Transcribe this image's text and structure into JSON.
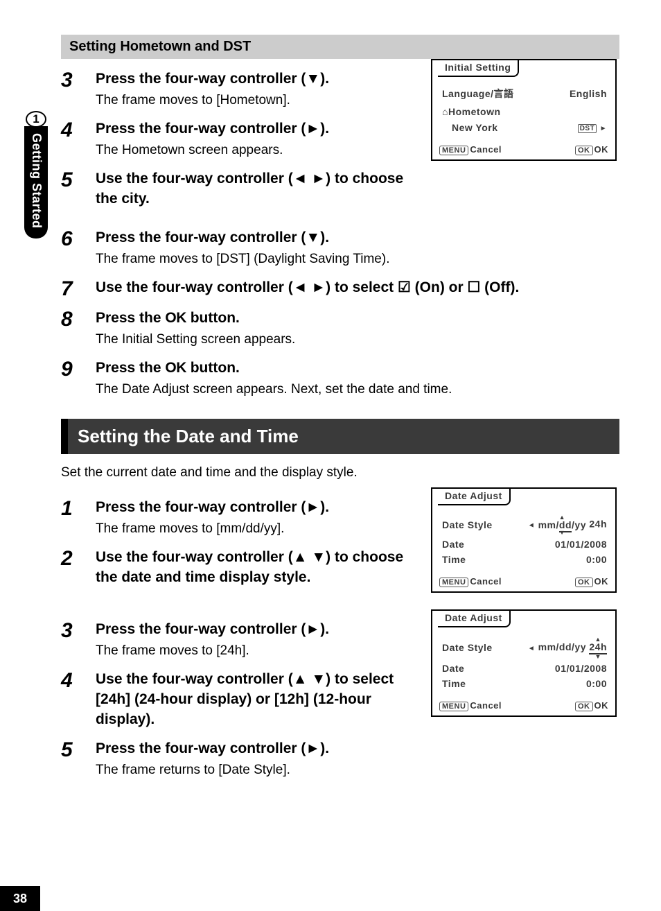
{
  "pageNumber": "38",
  "sideTab": {
    "chapter": "1",
    "label": "Getting Started"
  },
  "subhead1": "Setting Hometown and DST",
  "stepsA": [
    {
      "n": "3",
      "title_pre": "Press the four-way controller (",
      "arrow": "▼",
      "title_post": ").",
      "desc": "The frame moves to [Hometown]."
    },
    {
      "n": "4",
      "title_pre": "Press the four-way controller (",
      "arrow": "►",
      "title_post": ").",
      "desc": "The Hometown screen appears."
    },
    {
      "n": "5",
      "title_pre": "Use the four-way controller (",
      "arrow": "◄ ►",
      "title_post": ") to choose the city.",
      "desc": ""
    },
    {
      "n": "6",
      "title_pre": "Press the four-way controller (",
      "arrow": "▼",
      "title_post": ").",
      "desc": "The frame moves to [DST] (Daylight Saving Time)."
    },
    {
      "n": "7",
      "title_pre": "Use the four-way controller (",
      "arrow": "◄ ►",
      "title_post": ") to select ",
      "icon_on": "☑",
      "mid": " (On) or ",
      "icon_off": "☐",
      "end": " (Off).",
      "desc": ""
    },
    {
      "n": "8",
      "title_pre": "Press the ",
      "ok": "OK",
      "title_post": " button.",
      "desc": "The Initial Setting screen appears."
    },
    {
      "n": "9",
      "title_pre": "Press the ",
      "ok": "OK",
      "title_post": " button.",
      "desc": "The Date Adjust screen appears. Next, set the date and time."
    }
  ],
  "sectionTitle": "Setting the Date and Time",
  "intro": "Set the current date and time and the display style.",
  "stepsB": [
    {
      "n": "1",
      "title_pre": "Press the four-way controller (",
      "arrow": "►",
      "title_post": ").",
      "desc": "The frame moves to [mm/dd/yy]."
    },
    {
      "n": "2",
      "title_pre": "Use the four-way controller (",
      "arrow": "▲ ▼",
      "title_post": ") to choose the date and time display style.",
      "desc": ""
    },
    {
      "n": "3",
      "title_pre": "Press the four-way controller (",
      "arrow": "►",
      "title_post": ").",
      "desc": "The frame moves to [24h]."
    },
    {
      "n": "4",
      "title_pre": "Use the four-way controller (",
      "arrow": "▲ ▼",
      "title_post": ") to select [24h] (24-hour display) or [12h] (12-hour display).",
      "desc": ""
    },
    {
      "n": "5",
      "title_pre": "Press the four-way controller (",
      "arrow": "►",
      "title_post": ").",
      "desc": "The frame returns to [Date Style]."
    }
  ],
  "lcd1": {
    "tab": "Initial Setting",
    "langLabel": "Language/言語",
    "langValue": "English",
    "homeIcon": "⌂",
    "homeLabel": "Hometown",
    "city": "New York",
    "dst": "DST",
    "menuBtn": "MENU",
    "cancel": "Cancel",
    "okBtn": "OK",
    "ok": "OK"
  },
  "lcd2": {
    "tab": "Date Adjust",
    "dateStyle": "Date Style",
    "fmt": "mm/dd/yy",
    "selPart": "dd",
    "hourMode": "24h",
    "dateLabel": "Date",
    "dateValue": "01/01/2008",
    "timeLabel": "Time",
    "timeValue": "0:00",
    "menuBtn": "MENU",
    "cancel": "Cancel",
    "okBtn": "OK",
    "ok": "OK"
  },
  "lcd3": {
    "tab": "Date Adjust",
    "dateStyle": "Date Style",
    "fmt": "mm/dd/yy",
    "hourMode": "24h",
    "dateLabel": "Date",
    "dateValue": "01/01/2008",
    "timeLabel": "Time",
    "timeValue": "0:00",
    "menuBtn": "MENU",
    "cancel": "Cancel",
    "okBtn": "OK",
    "ok": "OK"
  }
}
